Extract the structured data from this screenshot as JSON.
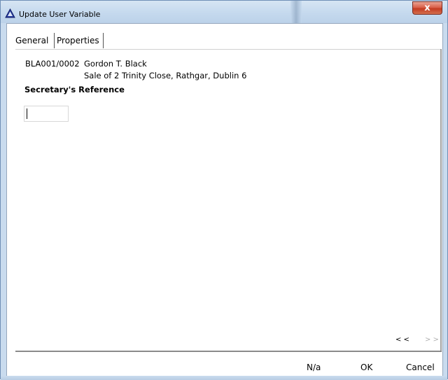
{
  "window": {
    "title": "Update User Variable",
    "close_label": "x",
    "icon": "warning-triangle-icon"
  },
  "tabs": [
    {
      "label": "General",
      "active": true
    },
    {
      "label": "Properties",
      "active": false
    }
  ],
  "matter": {
    "reference": "BLA001/0002",
    "client_name": "Gordon T. Black",
    "description": "Sale of 2 Trinity Close, Rathgar, Dublin 6"
  },
  "field": {
    "label": "Secretary's Reference",
    "value": ""
  },
  "navigation": {
    "prev_label": "< <",
    "next_label": "> >"
  },
  "buttons": {
    "na_label": "N/a",
    "ok_label": "OK",
    "cancel_label": "Cancel"
  },
  "colors": {
    "title_bar": "#c5d9ee",
    "close_button": "#c33b21",
    "disabled_text": "#b0b0b0"
  }
}
